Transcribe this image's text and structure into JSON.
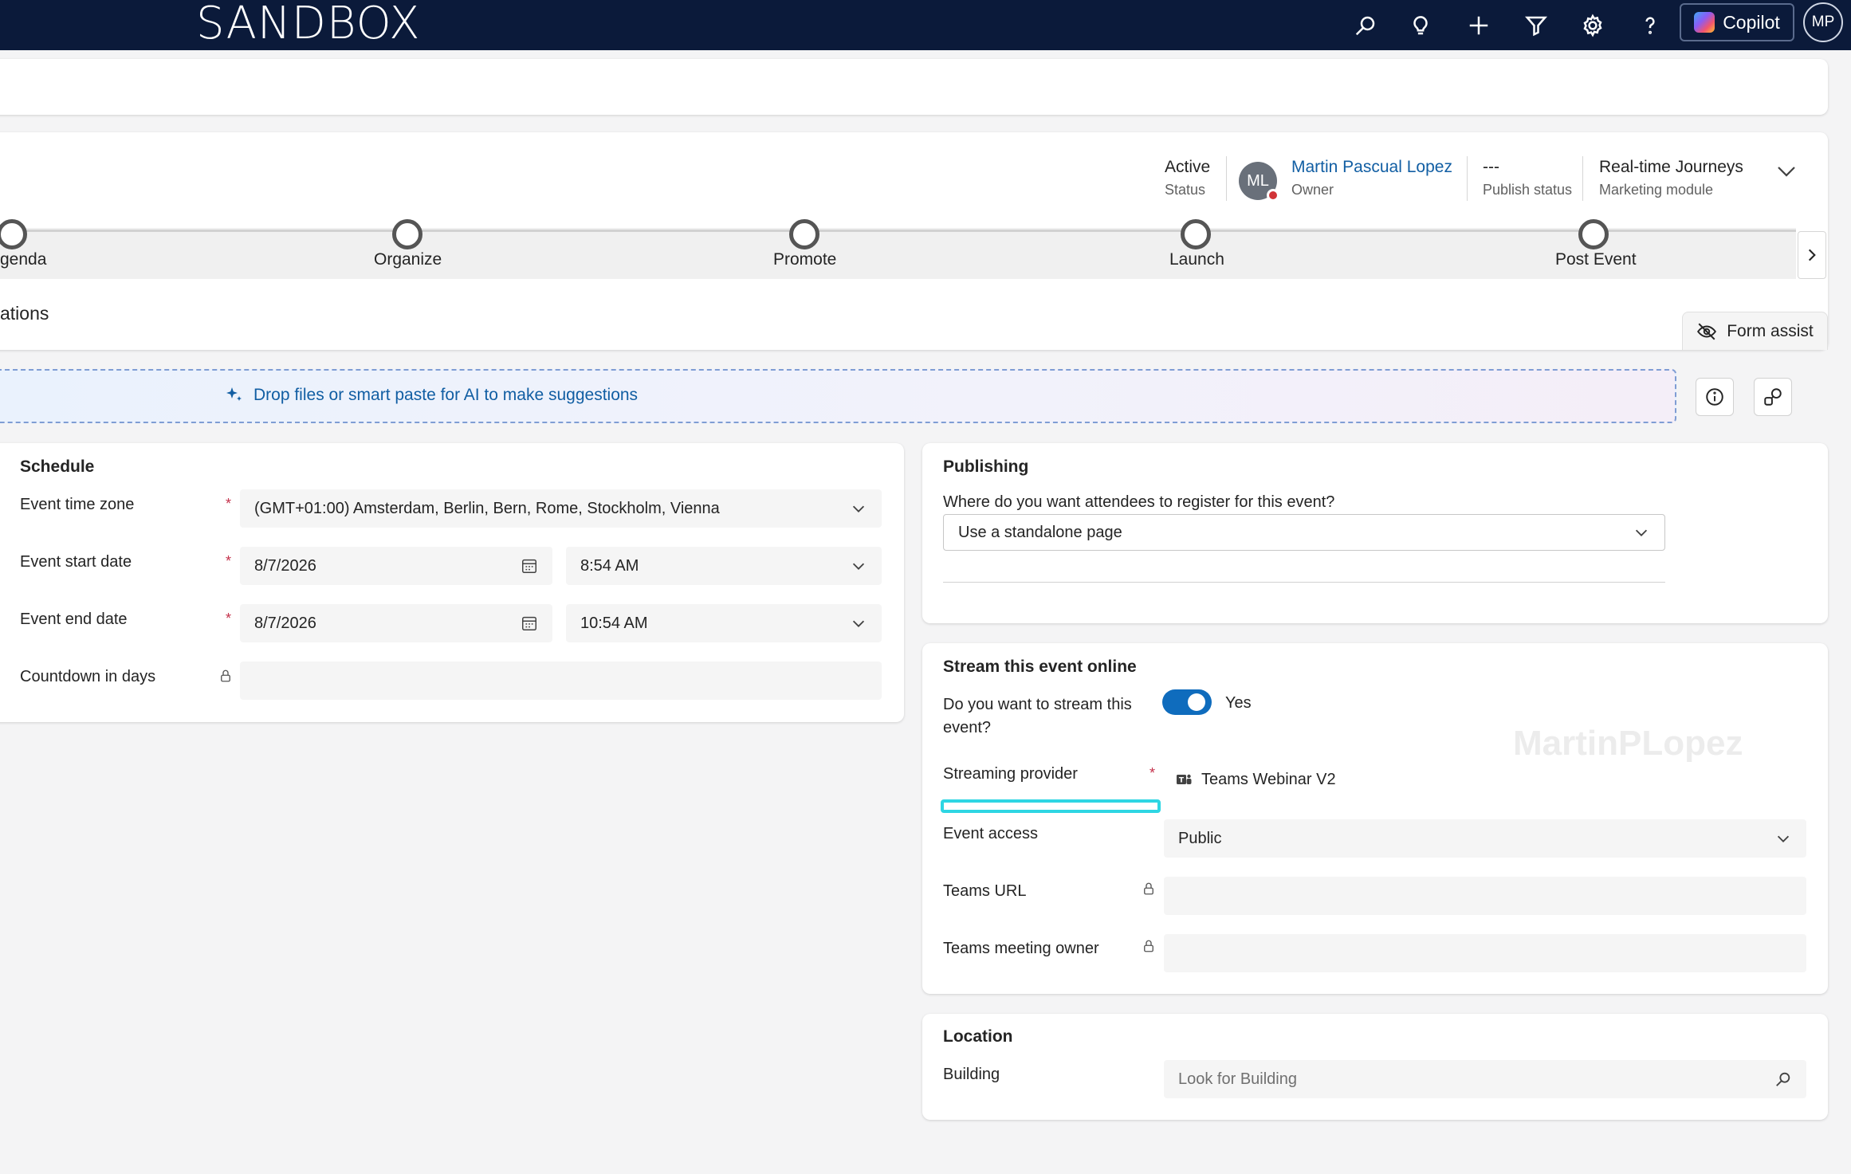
{
  "topbar": {
    "brand": "SANDBOX",
    "icons": [
      "search-icon",
      "lightbulb-icon",
      "plus-icon",
      "filter-icon",
      "gear-icon",
      "help-icon"
    ],
    "copilot_label": "Copilot",
    "user_initials": "MP"
  },
  "header": {
    "status_value": "Active",
    "status_label": "Status",
    "owner_initials": "ML",
    "owner_name": "Martin Pascual Lopez",
    "owner_label": "Owner",
    "publish_value": "---",
    "publish_label": "Publish status",
    "module_value": "Real-time Journeys",
    "module_label": "Marketing module"
  },
  "process": {
    "stages": [
      "genda",
      "Organize",
      "Promote",
      "Launch",
      "Post Event"
    ]
  },
  "tab": {
    "label": "ations"
  },
  "form_assist": {
    "label": "Form assist"
  },
  "dropzone": {
    "text": "Drop files or smart paste for AI to make suggestions"
  },
  "schedule": {
    "title": "Schedule",
    "timezone_label": "Event time zone",
    "timezone_value": "(GMT+01:00) Amsterdam, Berlin, Bern, Rome, Stockholm, Vienna",
    "start_label": "Event start date",
    "start_date": "8/7/2026",
    "start_time": "8:54 AM",
    "end_label": "Event end date",
    "end_date": "8/7/2026",
    "end_time": "10:54 AM",
    "countdown_label": "Countdown in days",
    "countdown_value": "",
    "required_mark": "*"
  },
  "publishing": {
    "title": "Publishing",
    "question": "Where do you want attendees to register for this event?",
    "value": "Use a standalone page"
  },
  "stream": {
    "title": "Stream this event online",
    "question_line1": "Do you want to stream this",
    "question_line2": "event?",
    "toggle_on": true,
    "toggle_label": "Yes",
    "provider_label": "Streaming provider",
    "provider_value": "Teams Webinar V2",
    "access_label": "Event access",
    "access_value": "Public",
    "teams_url_label": "Teams URL",
    "teams_url_value": "",
    "owner_label": "Teams meeting owner",
    "owner_value": "",
    "required_mark": "*",
    "watermark": "MartinPLopez"
  },
  "location": {
    "title": "Location",
    "building_label": "Building",
    "building_placeholder": "Look for Building"
  }
}
